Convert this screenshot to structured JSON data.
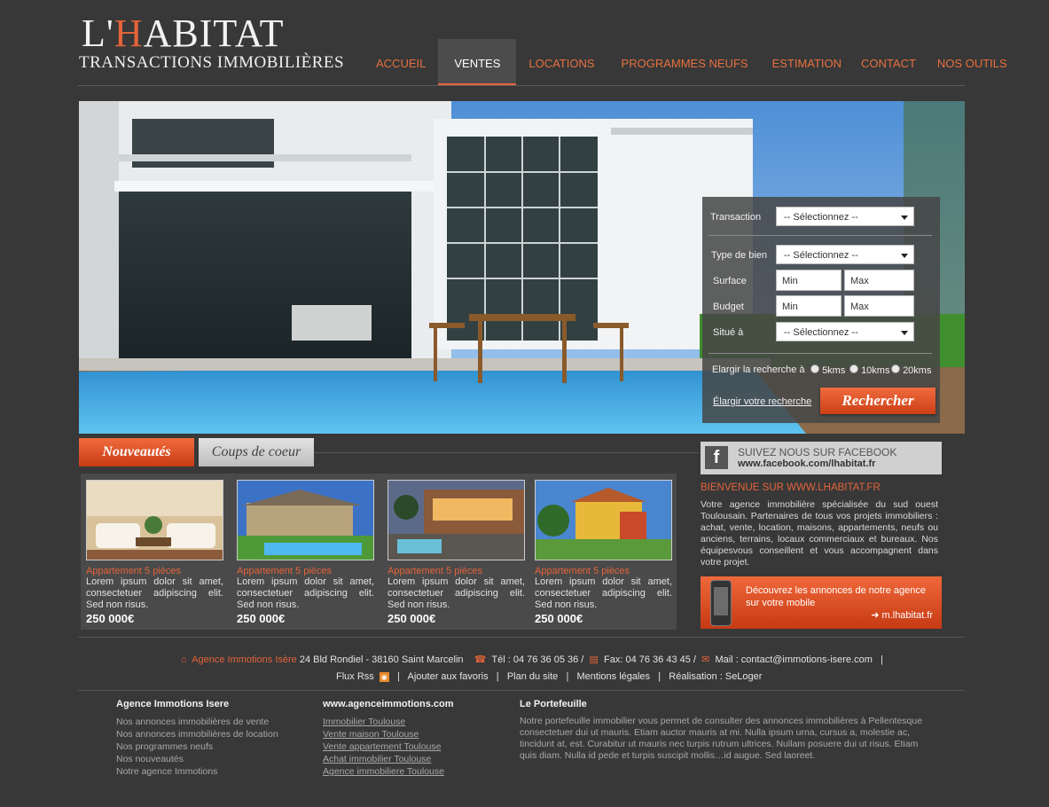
{
  "header": {
    "logo_main": "L'",
    "logo_h": "H",
    "logo_rest": "ABITAT",
    "logo_sub": "TRANSACTIONS IMMOBILIÈRES",
    "nav": [
      "ACCUEIL",
      "VENTES",
      "LOCATIONS",
      "PROGRAMMES NEUFS",
      "ESTIMATION",
      "CONTACT",
      "NOS OUTILS"
    ],
    "active_nav": "VENTES"
  },
  "search": {
    "transaction_label": "Transaction",
    "transaction_value": "-- Sélectionnez --",
    "type_label": "Type de bien",
    "type_value": "-- Sélectionnez --",
    "surface_label": "Surface",
    "budget_label": "Budget",
    "min_placeholder": "Min",
    "max_placeholder": "Max",
    "situe_label": "Situé à",
    "situe_value": "-- Sélectionnez --",
    "elargir_label": "Elargir la recherche à",
    "radius_options": [
      "5kms",
      "10kms",
      "20kms"
    ],
    "elargir_link": "Élargir votre recherche",
    "submit": "Rechercher"
  },
  "tabs": {
    "active": "Nouveautés",
    "inactive": "Coups de coeur"
  },
  "listings": [
    {
      "title": "Appartement 5 pièces",
      "desc": "Lorem ipsum dolor sit amet, consectetuer adipiscing elit. Sed non risus.",
      "price": "250 000€"
    },
    {
      "title": "Appartement 5 pièces",
      "desc": "Lorem ipsum dolor sit amet, consectetuer adipiscing elit. Sed non risus.",
      "price": "250 000€"
    },
    {
      "title": "Appartement 5 pièces",
      "desc": "Lorem ipsum dolor sit amet, consectetuer adipiscing elit. Sed non risus.",
      "price": "250 000€"
    },
    {
      "title": "Appartement 5 pièces",
      "desc": "Lorem ipsum dolor sit amet, consectetuer adipiscing elit. Sed non risus.",
      "price": "250 000€"
    }
  ],
  "sidebar": {
    "fb_title": "SUIVEZ NOUS SUR FACEBOOK",
    "fb_url": "www.facebook.com/lhabitat.fr",
    "welcome_title": "BIENVENUE SUR WWW.LHABITAT.FR",
    "welcome_text": "Votre agence immobilière spécialisée du sud ouest Toulousain. Partenaires de tous vos projets immobiliers : achat, vente, location, maisons, appartements, neufs ou anciens, terrains, locaux commerciaux et bureaux. Nos équipesvous conseillent et vous accompagnent dans votre projet.",
    "mobile_text": "Découvrez les annonces de notre agence sur votre mobile",
    "mobile_link": "m.lhabitat.fr"
  },
  "footer": {
    "agency_name": "Agence Immotions Isère",
    "address": " 24 Bld Rondiel - 38160 Saint Marcelin",
    "tel": "Tél : 04 76 36 05 36 /",
    "fax": "Fax: 04 76 36 43 45 /",
    "mail": "Mail : contact@immotions-isere.com",
    "sep": "|",
    "links": [
      "Flux Rss",
      "Ajouter aux favoris",
      "Plan du site",
      "Mentions légales",
      "Réalisation : SeLoger"
    ],
    "col1_title": "Agence Immotions Isere",
    "col1_items": [
      "Nos annonces immobilières de vente",
      "Nos annonces immobilières de location",
      "Nos programmes neufs",
      "Nos nouveautés",
      "Notre agence Immotions"
    ],
    "col2_title": "www.agenceimmotions.com",
    "col2_items": [
      "Immobilier Toulouse",
      "Vente maison Toulouse",
      "Vente appartement Toulouse",
      "Achat immobilier Toulouse",
      "Agence immobiliere Toulouse"
    ],
    "col3_title": "Le Portefeuille",
    "col3_text": "Notre portefeuille immobilier vous permet de consulter des annonces immobilières à Pellentesque consectetuer dui ut mauris. Etiam auctor mauris at mi. Nulla ipsum urna, cursus a, molestie ac, tincidunt at, est. Curabitur ut mauris nec turpis rutrum ultrices. Nullam posuere dui ut risus. Etiam quis diam. Nulla id pede et turpis suscipit mollis…id augue. Sed laoreet."
  },
  "colors": {
    "accent": "#e4643a",
    "background": "#383838"
  }
}
